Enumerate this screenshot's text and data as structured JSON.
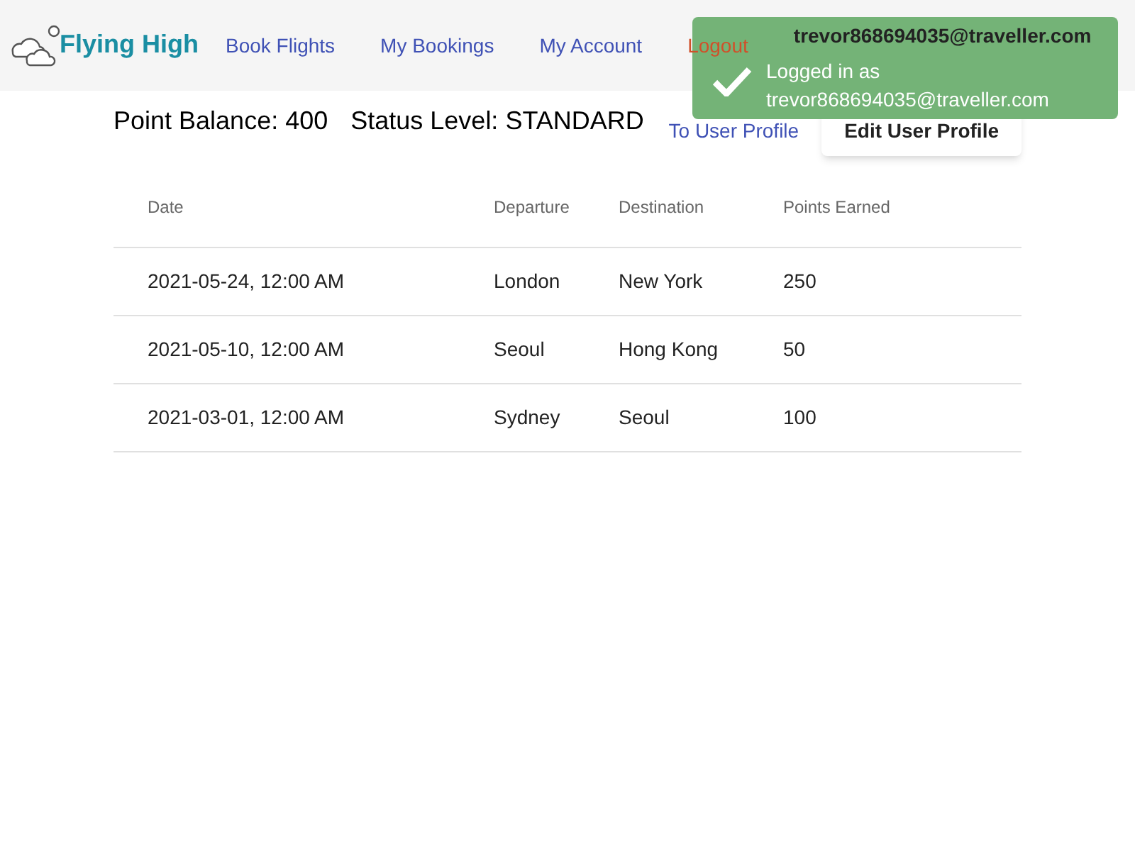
{
  "nav": {
    "brand": "Flying High",
    "links": [
      {
        "label": "Book Flights",
        "kind": "link"
      },
      {
        "label": "My Bookings",
        "kind": "link"
      },
      {
        "label": "My Account",
        "kind": "link"
      },
      {
        "label": "Logout",
        "kind": "logout"
      }
    ],
    "user": "trevor868694035@traveller.com"
  },
  "toast": {
    "title": "Logged in as",
    "message": "trevor868694035@traveller.com"
  },
  "summary": {
    "points": "Point Balance: 400",
    "status": "Status Level: STANDARD"
  },
  "actions": {
    "link": "To User Profile",
    "button": "Edit User Profile"
  },
  "table": {
    "columns": [
      "Date",
      "Departure",
      "Destination",
      "Points Earned"
    ],
    "rows": [
      [
        "2021-05-24, 12:00 AM",
        "London",
        "New York",
        "250"
      ],
      [
        "2021-05-10, 12:00 AM",
        "Seoul",
        "Hong Kong",
        "50"
      ],
      [
        "2021-03-01, 12:00 AM",
        "Sydney",
        "Seoul",
        "100"
      ]
    ]
  }
}
